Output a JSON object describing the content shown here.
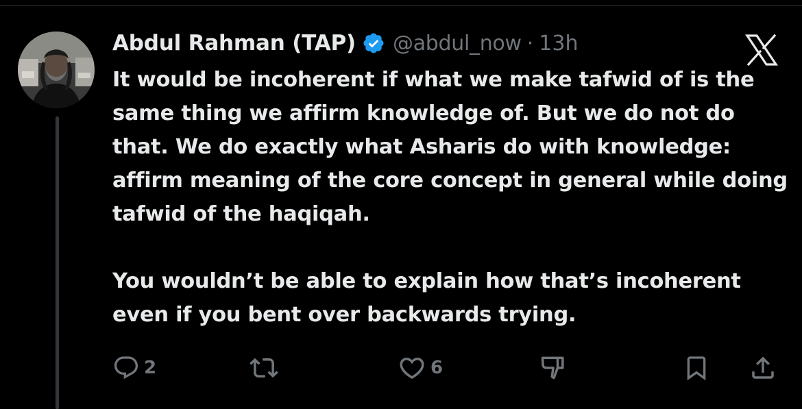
{
  "tweet": {
    "author": {
      "display_name": "Abdul Rahman (TAP)",
      "handle": "@abdul_now",
      "separator": "·",
      "time": "13h",
      "verified": true
    },
    "paragraphs": [
      "It would be incoherent if what we make tafwid of is the same thing we affirm knowledge of. But we do not do that. We do exactly what Asharis do with knowledge: affirm meaning of the core concept in general while doing tafwid of the haqiqah.",
      "You wouldn’t be able to explain how that’s incoherent even if you bent over backwards trying."
    ]
  },
  "actions": {
    "reply_count": "2",
    "like_count": "6"
  },
  "icons": {
    "verified": "verified-badge-icon",
    "brand": "x-logo-icon",
    "reply": "reply-icon",
    "retweet": "retweet-icon",
    "like": "heart-icon",
    "dislike": "dislike-icon",
    "bookmark": "bookmark-icon",
    "share": "share-icon"
  },
  "colors": {
    "background": "#000000",
    "text_primary": "#e7e9ea",
    "text_secondary": "#71767b",
    "verified_blue": "#1d9bf0",
    "thread_line": "#333639"
  }
}
